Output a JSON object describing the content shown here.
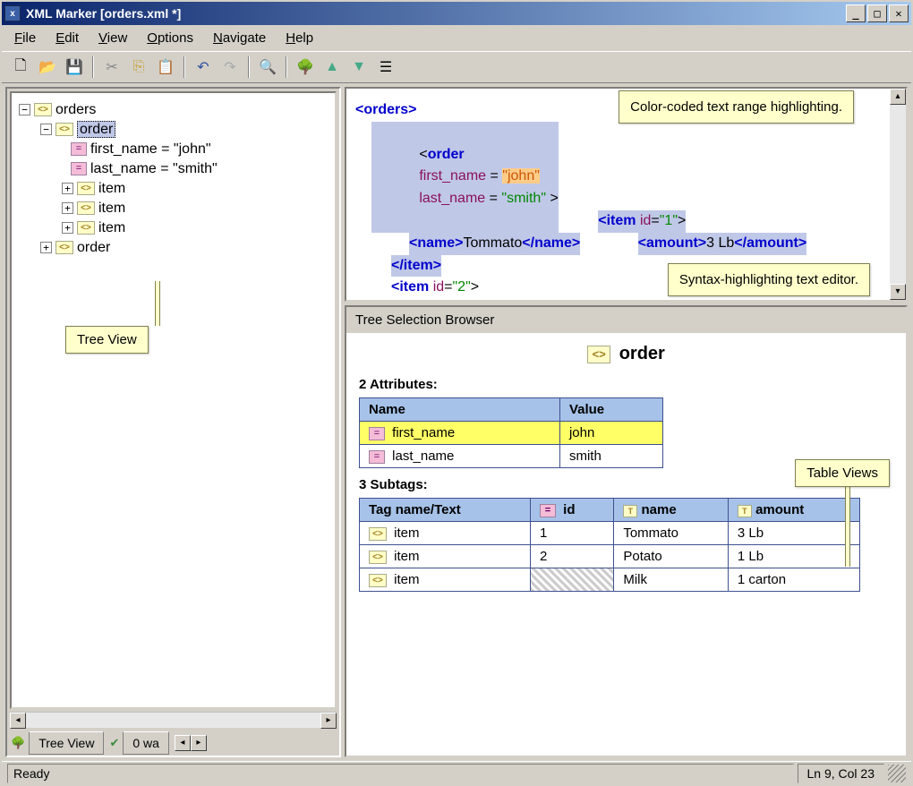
{
  "title": "XML Marker  [orders.xml *]",
  "menus": {
    "file": "File",
    "edit": "Edit",
    "view": "View",
    "options": "Options",
    "navigate": "Navigate",
    "help": "Help"
  },
  "tree": {
    "root": "orders",
    "order": "order",
    "first_attr": "first_name = \"john\"",
    "last_attr": "last_name = \"smith\"",
    "item": "item",
    "order2": "order"
  },
  "tabs": {
    "treeview": "Tree View",
    "warnings": "0 wa"
  },
  "callouts": {
    "treeview": "Tree View",
    "colorcode": "Color-coded text range highlighting.",
    "syntax": "Syntax-highlighting text editor.",
    "tableviews": "Table Views"
  },
  "editor": {
    "orders_open": "<orders>",
    "order_tag": "order",
    "first_name_attr": "first_name",
    "first_name_val": "\"john\"",
    "last_name_attr": "last_name",
    "last_name_val": "\"smith\"",
    "item_open": "<item",
    "id_attr": "id",
    "id_val1": "\"1\"",
    "name_open": "<name>",
    "name_close": "</name>",
    "amount_open": "<amount>",
    "amount_close": "</amount>",
    "item_close": "</item>",
    "id_val2": "\"2\"",
    "tommato": "Tommato",
    "qty": "3 Lb"
  },
  "browser": {
    "title": "Tree Selection Browser",
    "element": "order",
    "attrs_label": "2 Attributes:",
    "subtags_label": "3 Subtags:",
    "attr_hdr_name": "Name",
    "attr_hdr_value": "Value",
    "attr1_name": "first_name",
    "attr1_value": "john",
    "attr2_name": "last_name",
    "attr2_value": "smith",
    "sub_hdr_tag": "Tag name/Text",
    "sub_hdr_id": "id",
    "sub_hdr_name": "name",
    "sub_hdr_amount": "amount",
    "r1_tag": "item",
    "r1_id": "1",
    "r1_name": "Tommato",
    "r1_amt": "3 Lb",
    "r2_tag": "item",
    "r2_id": "2",
    "r2_name": "Potato",
    "r2_amt": "1 Lb",
    "r3_tag": "item",
    "r3_id": "",
    "r3_name": "Milk",
    "r3_amt": "1 carton"
  },
  "status": {
    "ready": "Ready",
    "pos": "Ln 9, Col 23"
  }
}
